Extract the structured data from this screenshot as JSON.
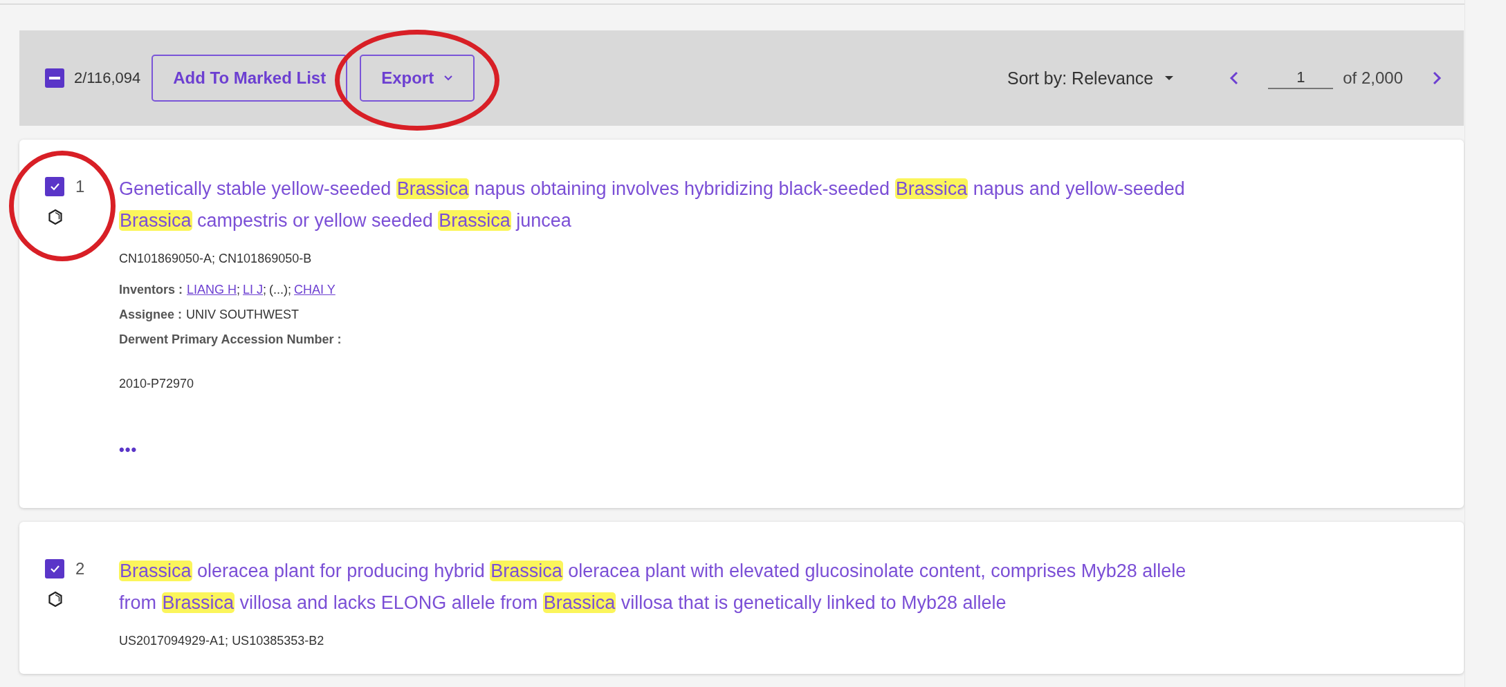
{
  "toolbar": {
    "select_all": {
      "partial": true,
      "count": "2/116,094"
    },
    "buttons": [
      {
        "label": "Add To Marked List",
        "kind": "plain",
        "circled": false
      },
      {
        "label": "Export",
        "kind": "dropdown",
        "circled": true
      }
    ],
    "sort": {
      "label": "Sort by: Relevance"
    },
    "pager": {
      "page": "1",
      "of": "of 2,000"
    }
  },
  "results": [
    {
      "number": "1",
      "checked": true,
      "circled": true,
      "title": [
        {
          "text": "Genetically stable yellow-seeded ",
          "highlight": false
        },
        {
          "text": "Brassica",
          "highlight": true
        },
        {
          "text": " napus obtaining involves hybridizing black-seeded ",
          "highlight": false
        },
        {
          "text": "Brassica",
          "highlight": true
        },
        {
          "text": " napus and yellow-seeded ",
          "highlight": false
        },
        {
          "text": "Brassica",
          "highlight": true
        },
        {
          "text": " campestris or yellow seeded ",
          "highlight": false
        },
        {
          "text": "Brassica",
          "highlight": true
        },
        {
          "text": " juncea",
          "highlight": false
        }
      ],
      "patents": "CN101869050-A; CN101869050-B",
      "inventors": {
        "label": "Inventors :",
        "names": [
          {
            "text": "LIANG H",
            "link": true,
            "sep": ";"
          },
          {
            "text": "LI J",
            "link": true,
            "sep": ";"
          },
          {
            "text": "(...)",
            "link": false,
            "sep": ";"
          },
          {
            "text": "CHAI Y",
            "link": true
          }
        ]
      },
      "assignee": {
        "label": "Assignee :",
        "value": "UNIV SOUTHWEST"
      },
      "accession": {
        "label": "Derwent Primary Accession Number :",
        "value": "2010-P72970"
      },
      "more": "•••"
    },
    {
      "number": "2",
      "checked": true,
      "circled": false,
      "title": [
        {
          "text": "Brassica",
          "highlight": true
        },
        {
          "text": " oleracea plant for producing hybrid ",
          "highlight": false
        },
        {
          "text": "Brassica",
          "highlight": true
        },
        {
          "text": " oleracea plant with elevated glucosinolate content, comprises Myb28 allele from ",
          "highlight": false
        },
        {
          "text": "Brassica",
          "highlight": true
        },
        {
          "text": " villosa and lacks ELONG allele from ",
          "highlight": false
        },
        {
          "text": "Brassica",
          "highlight": true
        },
        {
          "text": " villosa that is genetically linked to Myb28 allele",
          "highlight": false
        }
      ],
      "patents": "US2017094929-A1; US10385353-B2"
    }
  ]
}
